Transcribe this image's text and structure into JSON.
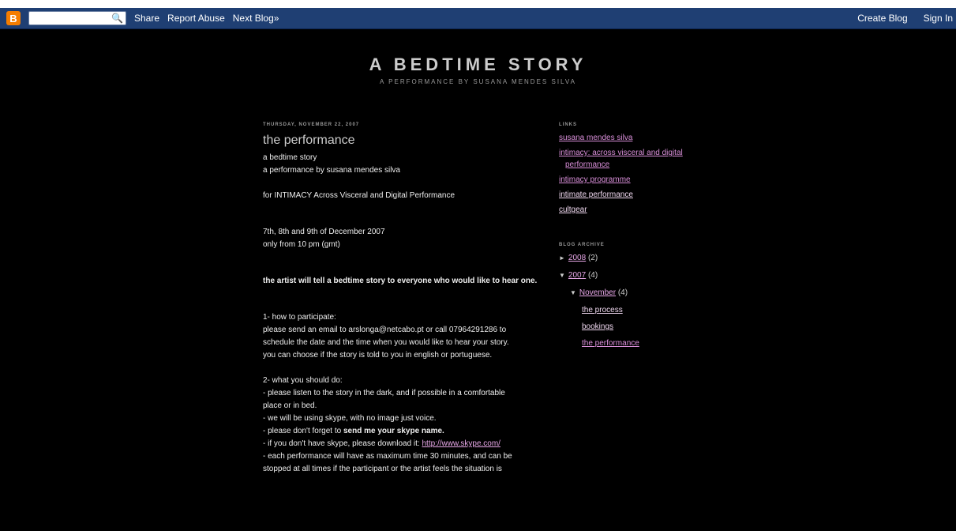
{
  "navbar": {
    "logo": "B",
    "search_placeholder": "",
    "links": [
      "Share",
      "Report Abuse",
      "Next Blog»"
    ],
    "right_links": [
      "Create Blog",
      "Sign In"
    ],
    "search_icon": "🔍",
    "colors": {
      "bg": "#1f3f73",
      "logo": "#f57d00"
    }
  },
  "header": {
    "title": "A BEDTIME STORY",
    "subtitle": "A PERFORMANCE BY SUSANA MENDES SILVA"
  },
  "post": {
    "date": "THURSDAY, NOVEMBER 22, 2007",
    "title": "the performance",
    "lines": {
      "l1": "a bedtime story",
      "l2": "a performance by susana mendes silva",
      "l3": "for INTIMACY Across Visceral and Digital Performance",
      "l4": "7th, 8th and 9th of December 2007",
      "l5": "only from 10 pm (gmt)",
      "l6": "the artist will tell a bedtime story to everyone who would like to hear one.",
      "l7": "1- how to participate:",
      "l8": "please send an email to arslonga@netcabo.pt or call 07964291286 to",
      "l9": "schedule the date and the time when you would like to hear your story.",
      "l10": "you can choose if the story is told to you in english or portuguese.",
      "l11": "2- what you should do:",
      "l12": "- please listen to the story in the dark, and if possible in a comfortable",
      "l13": "place or in bed.",
      "l14": "- we will be using skype, with no image just voice.",
      "l15a": "- please don't forget to ",
      "l15b": "send me your skype name.",
      "l16a": "- if you don't have skype, please download it: ",
      "l16b": "http://www.skype.com/",
      "l17": "- each performance will have as maximum time 30 minutes, and can be",
      "l18": "stopped at all times if the participant or the artist feels the situation is"
    }
  },
  "sidebar": {
    "links_heading": "LINKS",
    "links": [
      "susana mendes silva",
      "intimacy: across visceral and digital",
      "performance",
      "intimacy programme",
      "intimate performance",
      "cultgear"
    ],
    "archive_heading": "BLOG ARCHIVE",
    "archive": {
      "y2008": "2008",
      "y2008_count": "(2)",
      "y2007": "2007",
      "y2007_count": "(4)",
      "november": "November",
      "november_count": "(4)",
      "posts": [
        "the process",
        "bookings",
        "the performance"
      ],
      "tri_right": "►",
      "tri_down": "▼"
    }
  }
}
